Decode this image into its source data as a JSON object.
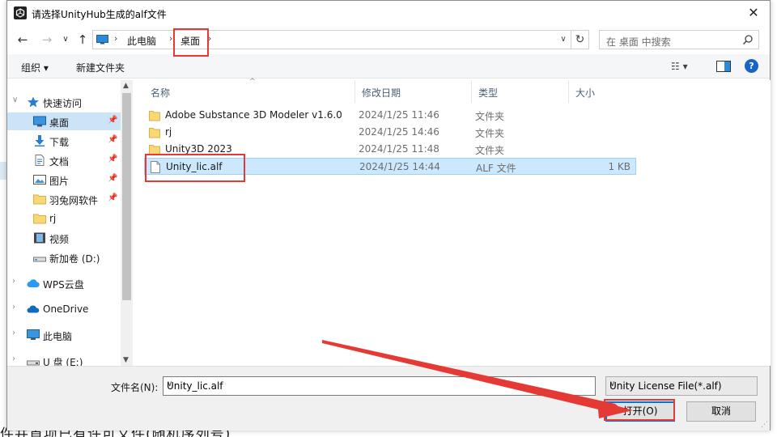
{
  "background": {
    "partial_text": "件并首项已有许可文件(随机序列号)"
  },
  "dialog": {
    "title": "请选择UnityHub生成的alf文件",
    "close_glyph": "✕"
  },
  "address": {
    "breadcrumbs": [
      "此电脑",
      "桌面"
    ],
    "search_placeholder": "在 桌面 中搜索"
  },
  "toolbar": {
    "organize_label": "组织 ▾",
    "new_folder_label": "新建文件夹"
  },
  "nav_pane": {
    "items": [
      {
        "label": "快速访问",
        "icon": "star-icon"
      },
      {
        "label": "桌面",
        "icon": "desktop-icon",
        "pinned": true,
        "selected": true
      },
      {
        "label": "下载",
        "icon": "download-icon",
        "pinned": true
      },
      {
        "label": "文档",
        "icon": "document-icon",
        "pinned": true
      },
      {
        "label": "图片",
        "icon": "picture-icon",
        "pinned": true
      },
      {
        "label": "羽兔网软件",
        "icon": "folder-icon",
        "pinned": true
      },
      {
        "label": "rj",
        "icon": "folder-icon"
      },
      {
        "label": "视频",
        "icon": "video-icon"
      },
      {
        "label": "新加卷 (D:)",
        "icon": "drive-icon"
      },
      {
        "label": "WPS云盘",
        "icon": "cloud-icon"
      },
      {
        "label": "OneDrive",
        "icon": "onedrive-icon"
      },
      {
        "label": "此电脑",
        "icon": "pc-icon"
      },
      {
        "label": "U 盘 (E:)",
        "icon": "usb-drive-icon"
      }
    ]
  },
  "file_list": {
    "columns": [
      "名称",
      "修改日期",
      "类型",
      "大小"
    ],
    "rows": [
      {
        "name": "Adobe Substance 3D Modeler v1.6.0",
        "date": "2024/1/25 11:46",
        "type": "文件夹",
        "size": "",
        "icon": "folder-icon"
      },
      {
        "name": "rj",
        "date": "2024/1/25 14:46",
        "type": "文件夹",
        "size": "",
        "icon": "folder-icon"
      },
      {
        "name": "Unity3D 2023",
        "date": "2024/1/25 11:48",
        "type": "文件夹",
        "size": "",
        "icon": "folder-icon"
      },
      {
        "name": "Unity_lic.alf",
        "date": "2024/1/25 14:44",
        "type": "ALF 文件",
        "size": "1 KB",
        "icon": "file-icon",
        "selected": true
      }
    ]
  },
  "bottom": {
    "filename_label": "文件名(N):",
    "filename_value": "Unity_lic.alf",
    "filter_value": "Unity License File(*.alf)",
    "open_label": "打开(O)",
    "cancel_label": "取消"
  },
  "colors": {
    "accent": "#0078d7",
    "selection": "#cce8ff",
    "annotation_red": "#e53935",
    "folder_yellow": "#f8d775"
  }
}
